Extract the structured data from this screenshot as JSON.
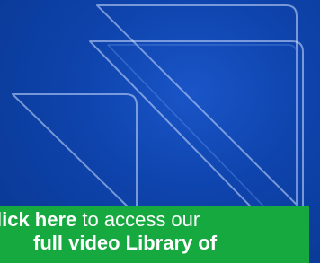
{
  "banner": {
    "link_text": "lick here",
    "text_after_link": " to access our",
    "line2_bold": "full video Library of",
    "background_color": "#16a93f",
    "page_background": "#0a3d9e"
  },
  "decor": {
    "icon": "triangle-outline-pattern-icon"
  }
}
